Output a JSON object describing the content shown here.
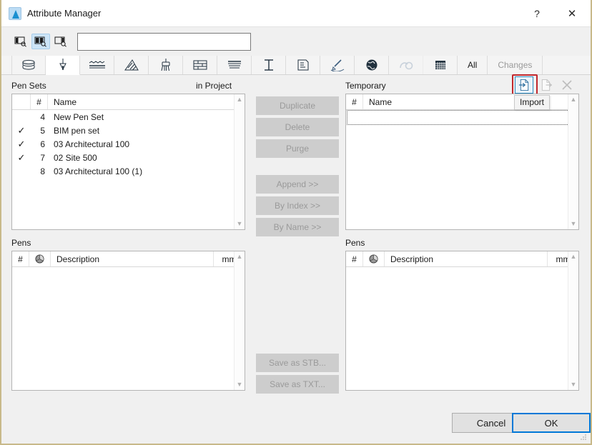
{
  "window": {
    "title": "Attribute Manager",
    "app_icon": "archicad-icon",
    "help_label": "?",
    "close_label": "✕"
  },
  "searchbar": {
    "scope_buttons": [
      {
        "name": "search-scope-left-icon",
        "selected": false
      },
      {
        "name": "search-scope-both-icon",
        "selected": true
      },
      {
        "name": "search-scope-right-icon",
        "selected": false
      }
    ],
    "input_value": "",
    "input_placeholder": ""
  },
  "tabs": [
    {
      "icon": "layers-icon",
      "name": "tab-building-materials",
      "active": false,
      "dim": false
    },
    {
      "icon": "pen-nib-icon",
      "name": "tab-pens",
      "active": true,
      "dim": false
    },
    {
      "icon": "line-types-icon",
      "name": "tab-line-types",
      "active": false,
      "dim": false
    },
    {
      "icon": "fill-types-icon",
      "name": "tab-fill-types",
      "active": false,
      "dim": false
    },
    {
      "icon": "surface-brush-icon",
      "name": "tab-surfaces",
      "active": false,
      "dim": false
    },
    {
      "icon": "composite-icon",
      "name": "tab-composites",
      "active": false,
      "dim": false
    },
    {
      "icon": "zone-category-icon",
      "name": "tab-zone-categories",
      "active": false,
      "dim": false
    },
    {
      "icon": "profile-icon",
      "name": "tab-profiles",
      "active": false,
      "dim": false
    },
    {
      "icon": "layer-combination-icon",
      "name": "tab-layer-combinations",
      "active": false,
      "dim": false
    },
    {
      "icon": "markup-pen-icon",
      "name": "tab-markup-styles",
      "active": false,
      "dim": false
    },
    {
      "icon": "globe-icon",
      "name": "tab-cities",
      "active": false,
      "dim": false
    },
    {
      "icon": "mep-system-icon",
      "name": "tab-mep-systems",
      "active": false,
      "dim": true
    },
    {
      "icon": "grid-icon",
      "name": "tab-grids",
      "active": false,
      "dim": false
    }
  ],
  "filters": [
    {
      "label": "All",
      "enabled": true
    },
    {
      "label": "Changes",
      "enabled": false
    }
  ],
  "left_panel": {
    "title": "Pen Sets",
    "source_label": "in Project",
    "columns": {
      "num": "#",
      "name": "Name"
    },
    "rows": [
      {
        "checked": "",
        "num": "4",
        "name": "New Pen Set"
      },
      {
        "checked": "✓",
        "num": "5",
        "name": "BIM pen set"
      },
      {
        "checked": "✓",
        "num": "6",
        "name": "03 Architectural 100"
      },
      {
        "checked": "✓",
        "num": "7",
        "name": "02 Site 500"
      },
      {
        "checked": "",
        "num": "8",
        "name": "03 Architectural 100 (1)"
      }
    ]
  },
  "left_pens": {
    "title": "Pens",
    "columns": {
      "num": "#",
      "wheel": "color-wheel-icon",
      "description": "Description",
      "mm": "mm"
    },
    "rows": []
  },
  "middle_buttons": [
    {
      "label": "Duplicate",
      "name": "duplicate-button",
      "enabled": false
    },
    {
      "label": "Delete",
      "name": "delete-button",
      "enabled": false
    },
    {
      "label": "Purge",
      "name": "purge-button",
      "enabled": false
    },
    {
      "label": "Append >>",
      "name": "append-button",
      "enabled": false
    },
    {
      "label": "By Index >>",
      "name": "by-index-button",
      "enabled": false
    },
    {
      "label": "By Name >>",
      "name": "by-name-button",
      "enabled": false
    },
    {
      "label": "Save as STB...",
      "name": "save-as-stb-button",
      "enabled": false
    },
    {
      "label": "Save as TXT...",
      "name": "save-as-txt-button",
      "enabled": false
    }
  ],
  "right_panel": {
    "title": "Temporary",
    "columns": {
      "num": "#",
      "name": "Name"
    },
    "rows": [],
    "actions": [
      {
        "name": "import-button",
        "icon": "import-icon",
        "enabled": true,
        "selected": true
      },
      {
        "name": "export-button",
        "icon": "export-icon",
        "enabled": false,
        "selected": false
      },
      {
        "name": "close-file-button",
        "icon": "close-x-icon",
        "enabled": false,
        "selected": false
      }
    ],
    "tooltip": "Import",
    "highlight_color": "#c0272d"
  },
  "right_pens": {
    "title": "Pens",
    "columns": {
      "num": "#",
      "wheel": "color-wheel-icon",
      "description": "Description",
      "mm": "mm"
    },
    "rows": []
  },
  "footer": {
    "cancel_label": "Cancel",
    "ok_label": "OK",
    "accent_color": "#0078d7"
  }
}
